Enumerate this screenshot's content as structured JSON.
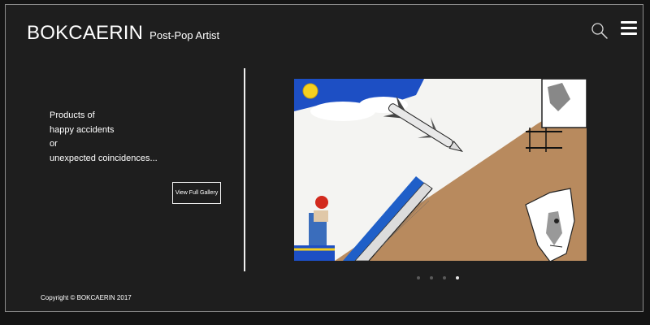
{
  "header": {
    "brand_name": "BOKCAERIN",
    "tagline": "Post-Pop Artist",
    "search_icon": "search-icon",
    "menu_icon": "hamburger-menu-icon"
  },
  "intro": {
    "lines": [
      "Products of",
      "happy accidents",
      "or",
      "unexpected coincidences..."
    ]
  },
  "gallery": {
    "button_label": "View Full Gallery",
    "slide_count": 4,
    "active_slide_index": 3
  },
  "footer": {
    "copyright": "Copyright © BOKCAERIN 2017"
  },
  "colors": {
    "background": "#1e1e1e",
    "border": "#8c8c8c",
    "text": "#ffffff",
    "sky_blue": "#1d4fc4",
    "cork": "#b88a5e",
    "sun": "#f5d020",
    "helmet_red": "#d22a1e"
  }
}
